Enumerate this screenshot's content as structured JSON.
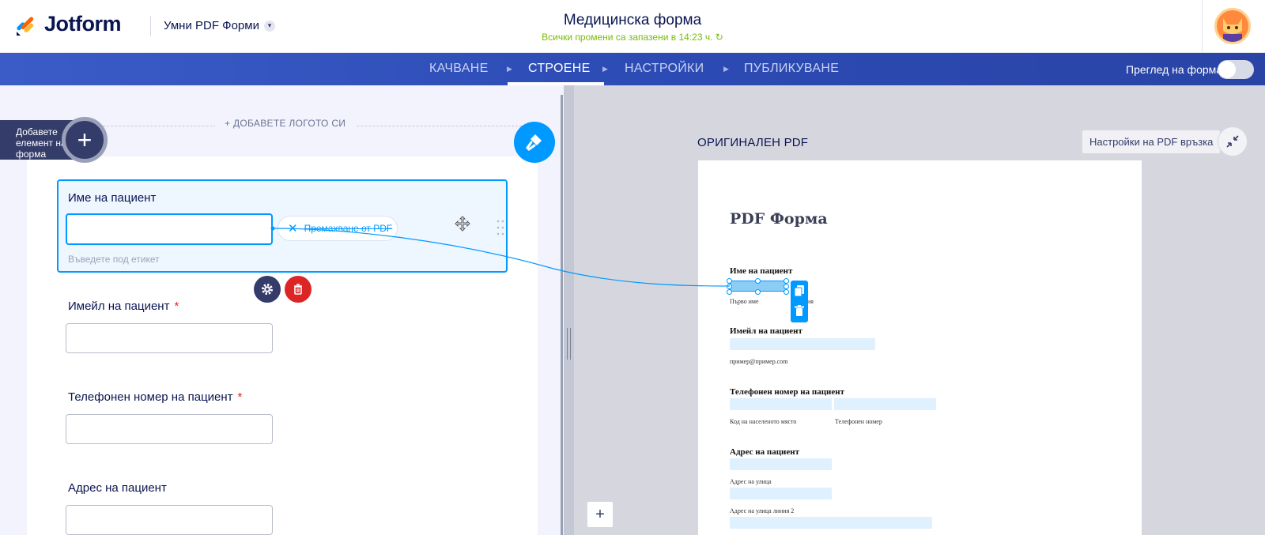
{
  "header": {
    "logo_text": "Jotform",
    "product_name": "Умни PDF Форми",
    "form_title": "Медицинска форма",
    "save_status": "Всички промени са запазени в 14:23 ч."
  },
  "nav": {
    "steps": [
      "КАЧВАНЕ",
      "СТРОЕНЕ",
      "НАСТРОЙКИ",
      "ПУБЛИКУВАНЕ"
    ],
    "active": "СТРОЕНЕ",
    "preview_label": "Преглед на форма",
    "preview_on": false
  },
  "builder": {
    "add_logo": "+ ДОБАВЕТЕ ЛОГОТО СИ",
    "add_element_label": "Добавете елемент на форма",
    "fields": [
      {
        "label": "Име на пациент",
        "required": false,
        "sublabel_placeholder": "Въведете под етикет",
        "selected": true
      },
      {
        "label": "Имейл на пациент",
        "required": true
      },
      {
        "label": "Телефонен номер на пациент",
        "required": true
      },
      {
        "label": "Адрес на пациент",
        "required": false
      }
    ],
    "required_mark": "*",
    "remove_from_pdf": "Премахване от PDF"
  },
  "pdf_panel": {
    "heading": "ОРИГИНАЛЕН PDF",
    "settings_button": "Настройки на PDF връзка",
    "zoom_in": "+",
    "doc_title": "PDF Форма",
    "labels": [
      "Име на пациент",
      "Имейл на пациент",
      "Телефонен номер на пациент",
      "Адрес на пациент"
    ],
    "sublabels": {
      "first_name": "Първо име",
      "last_name_partial": "ия",
      "email": "пример@пример.com",
      "area_code": "Код на населеното място",
      "phone": "Телефонен номер",
      "street": "Адрес на улица",
      "street2": "Адрес на улица линия 2"
    }
  },
  "colors": {
    "brand_navy": "#0a1551",
    "accent_blue": "#0099ff",
    "nav_blue": "#2c4bb5",
    "saved_green": "#78bb07",
    "danger_red": "#dc2626"
  }
}
